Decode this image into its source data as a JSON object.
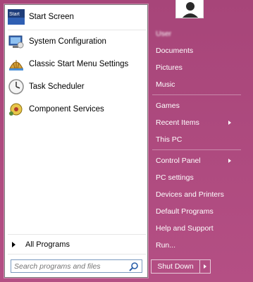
{
  "left": {
    "programs": [
      {
        "label": "Start Screen",
        "icon": "start-screen-icon"
      },
      {
        "label": "System Configuration",
        "icon": "system-configuration-icon"
      },
      {
        "label": "Classic Start Menu Settings",
        "icon": "classic-shell-icon"
      },
      {
        "label": "Task Scheduler",
        "icon": "clock-icon"
      },
      {
        "label": "Component Services",
        "icon": "component-services-icon"
      }
    ],
    "start_icon_text": "Start",
    "all_programs": "All Programs",
    "search_placeholder": "Search programs and files"
  },
  "right": {
    "user": "User",
    "items": [
      {
        "label": "Documents"
      },
      {
        "label": "Pictures"
      },
      {
        "label": "Music"
      },
      {
        "label": "Games"
      },
      {
        "label": "Recent Items"
      },
      {
        "label": "This PC"
      },
      {
        "label": "Control Panel"
      },
      {
        "label": "PC settings"
      },
      {
        "label": "Devices and Printers"
      },
      {
        "label": "Default Programs"
      },
      {
        "label": "Help and Support"
      },
      {
        "label": "Run..."
      }
    ],
    "shutdown": "Shut Down"
  },
  "colors": {
    "background": "#b84f86",
    "search_border": "#7a9abf"
  }
}
